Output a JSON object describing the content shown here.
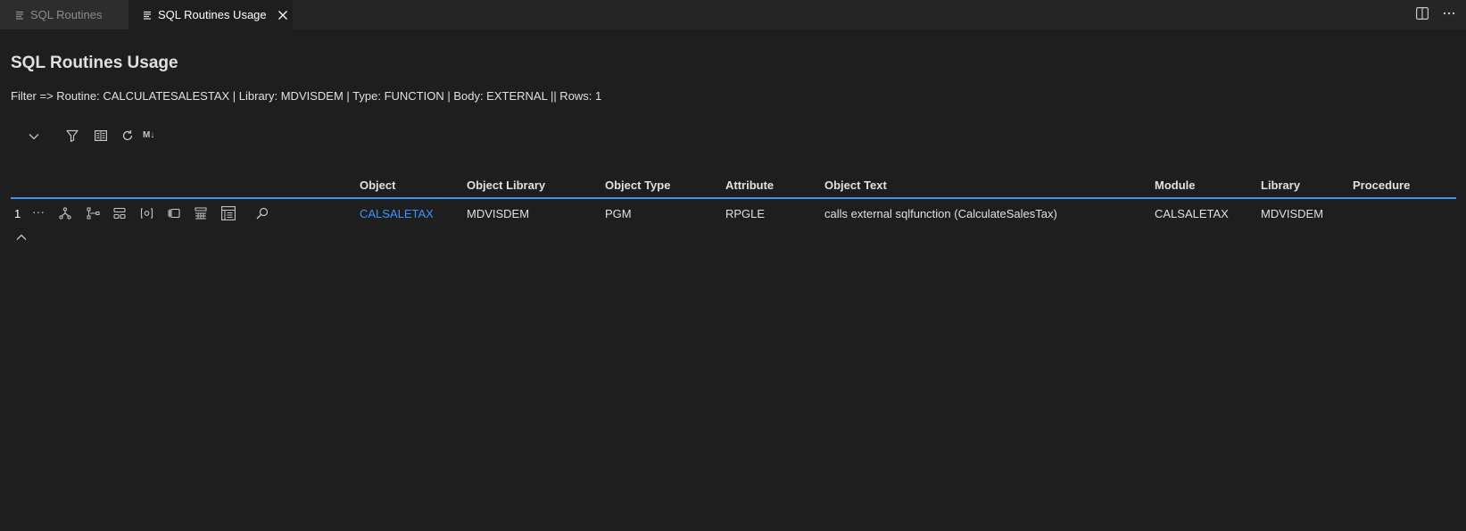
{
  "tabs": [
    {
      "label": "SQL Routines",
      "active": false
    },
    {
      "label": "SQL Routines Usage",
      "active": true
    }
  ],
  "page": {
    "title": "SQL Routines Usage",
    "filter": "Filter => Routine: CALCULATESALESTAX | Library: MDVISDEM | Type: FUNCTION | Body: EXTERNAL || Rows: 1"
  },
  "toolbar": {
    "markdown_label": "M↓"
  },
  "table": {
    "columns": [
      "Object",
      "Object Library",
      "Object Type",
      "Attribute",
      "Object Text",
      "Module",
      "Library",
      "Procedure"
    ],
    "rows": [
      {
        "num": "1",
        "more": "···",
        "object": "CALSALETAX",
        "object_library": "MDVISDEM",
        "object_type": "PGM",
        "attribute": "RPGLE",
        "object_text": "calls external sqlfunction (CalculateSalesTax)",
        "module": "CALSALETAX",
        "library": "MDVISDEM",
        "procedure": ""
      }
    ]
  },
  "colors": {
    "background": "#1e1e1e",
    "accent": "#3794ff",
    "tabbar": "#252526"
  }
}
